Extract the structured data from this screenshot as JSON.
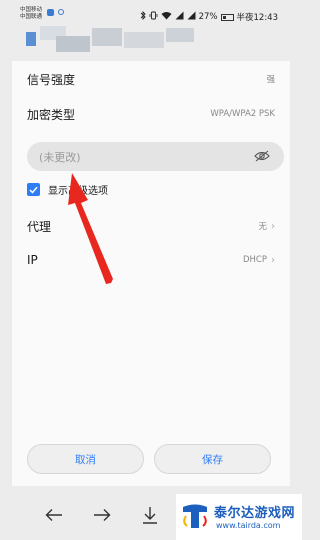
{
  "status_bar": {
    "carrier1": "中国移动",
    "carrier2": "中国联通",
    "icons": [
      "bluetooth-icon",
      "vibrate-icon",
      "wifi-icon",
      "signal-icon",
      "signal-icon",
      "alarm-icon"
    ],
    "battery_percent": "27%",
    "time": "半夜12:43"
  },
  "dialog": {
    "signal_strength": {
      "label": "信号强度",
      "value": "强"
    },
    "encryption": {
      "label": "加密类型",
      "value": "WPA/WPA2 PSK"
    },
    "password": {
      "placeholder": "(未更改)"
    },
    "advanced_option": {
      "label": "显示高级选项",
      "checked": true
    },
    "proxy": {
      "label": "代理",
      "value": "无"
    },
    "ip": {
      "label": "IP",
      "value": "DHCP"
    },
    "cancel_label": "取消",
    "save_label": "保存"
  },
  "toolbar": {
    "icons": [
      "back-arrow-icon",
      "forward-arrow-icon",
      "download-icon"
    ]
  },
  "watermark": {
    "title": "泰尔达游戏网",
    "url": "www.tairda.com"
  },
  "colors": {
    "accent": "#2f7df6",
    "arrow": "#e8281e",
    "background": "#ececec",
    "dialog": "#fafafa"
  }
}
